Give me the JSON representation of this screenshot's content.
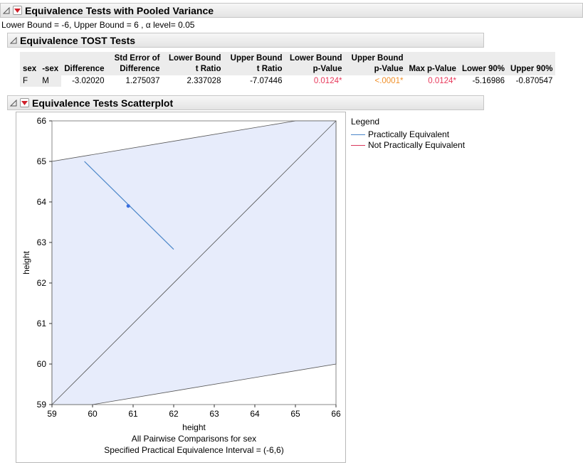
{
  "report": {
    "title": "Equivalence Tests with Pooled Variance",
    "subtitle": "Lower Bound = -6, Upper Bound = 6 , α level= 0.05"
  },
  "tost": {
    "title": "Equivalence TOST Tests",
    "headers": [
      "sex",
      "-sex",
      "Difference",
      "Std Error of Difference",
      "Lower Bound t Ratio",
      "Upper Bound t Ratio",
      "Lower Bound p-Value",
      "Upper Bound p-Value",
      "Max p-Value",
      "Lower 90%",
      "Upper 90%"
    ],
    "row": [
      "F",
      "M",
      "-3.02020",
      "1.275037",
      "2.337028",
      "-7.07446",
      "0.0124*",
      "<.0001*",
      "0.0124*",
      "-5.16986",
      "-0.870547"
    ]
  },
  "scatter": {
    "title": "Equivalence Tests Scatterplot",
    "legend_title": "Legend",
    "legend_items": [
      "Practically Equivalent",
      "Not Practically Equivalent"
    ],
    "caption1": "All Pairwise Comparisons for sex",
    "caption2": "Specified Practical Equivalence Interval = (-6,6)"
  },
  "colors": {
    "equivalent": "#4a86c8",
    "not_equivalent": "#d9385c",
    "region_fill": "#e7ecfb",
    "point": "#3a6fe0"
  },
  "chart_data": {
    "type": "scatter",
    "xlabel": "height",
    "ylabel": "height",
    "xlim": [
      59,
      66
    ],
    "ylim": [
      59,
      66
    ],
    "x_ticks": [
      59,
      60,
      61,
      62,
      63,
      64,
      65,
      66
    ],
    "y_ticks": [
      59,
      60,
      61,
      62,
      63,
      64,
      65,
      66
    ],
    "equivalence_interval": [
      -6,
      6
    ],
    "points": [
      {
        "x": 60.88,
        "y": 63.9,
        "ci_segment": [
          [
            59.8,
            65.0
          ],
          [
            62.0,
            62.83
          ]
        ],
        "status": "Practically Equivalent"
      }
    ]
  }
}
